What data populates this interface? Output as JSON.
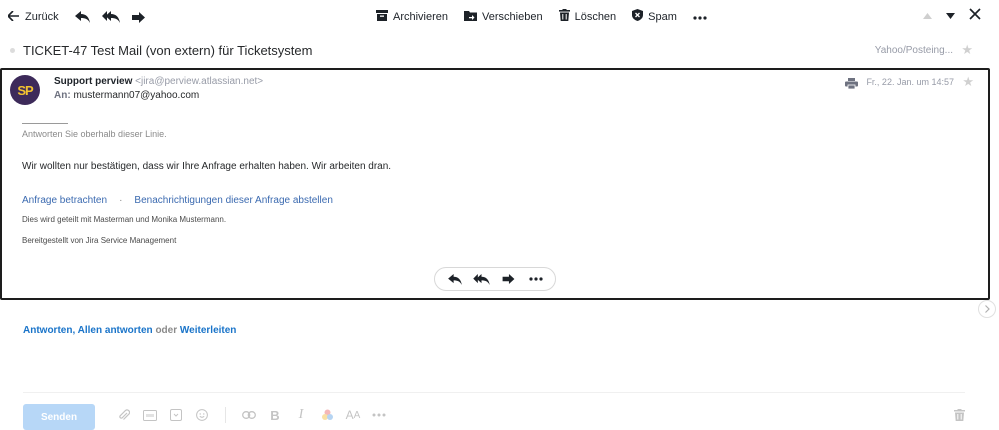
{
  "toolbar": {
    "back_label": "Zurück",
    "actions": [
      {
        "label": "Archivieren",
        "icon": "archive-icon"
      },
      {
        "label": "Verschieben",
        "icon": "move-icon"
      },
      {
        "label": "Löschen",
        "icon": "trash-icon"
      },
      {
        "label": "Spam",
        "icon": "spam-shield-icon"
      }
    ]
  },
  "email": {
    "subject": "TICKET-47 Test Mail (von extern) für Ticketsystem",
    "folder": "Yahoo/Posteing...",
    "sender_name": "Support perview",
    "sender_email": "<jira@perview.atlassian.net>",
    "recipient_label": "An:",
    "recipient": "mustermann07@yahoo.com",
    "date": "Fr., 22. Jan. um 14:57",
    "avatar_initials": "SP",
    "body": {
      "reply_above": "Antworten Sie oberhalb dieser Linie.",
      "message": "Wir wollten nur bestätigen, dass wir Ihre Anfrage erhalten haben. Wir arbeiten dran.",
      "link_view": "Anfrage betrachten",
      "link_separator": "·",
      "link_unsubscribe": "Benachrichtigungen dieser Anfrage abstellen",
      "shared_with": "Dies wird geteilt mit Masterman und Monika Mustermann.",
      "provided_by": "Bereitgestellt von Jira Service Management"
    }
  },
  "reply_bar": {
    "reply": "Antworten",
    "comma": ",",
    "reply_all": "Allen antworten",
    "or": "oder",
    "forward": "Weiterleiten"
  },
  "compose": {
    "send_label": "Senden"
  },
  "colors": {
    "link_blue": "#1a74c9",
    "body_link": "#3b6ab0",
    "send_disabled": "#b7d7f7",
    "avatar_bg": "#3d2a5a",
    "avatar_text": "#f2c230"
  }
}
